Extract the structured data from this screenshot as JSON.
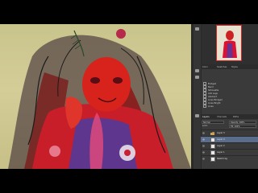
{
  "window": {
    "title": ""
  },
  "panels": {
    "mini_tabs": [
      "Navigator",
      "Histogram",
      "Info"
    ],
    "history_tabs": [
      "Color",
      "Swatches",
      "Styles"
    ],
    "history_items": [
      "Bridged",
      "Bend",
      "Silhouette",
      "Add Legs",
      "Abstract",
      "Lines Bridged",
      "Lines Bright",
      "Lines"
    ],
    "layer_tabs": [
      "Layers",
      "Channels",
      "Paths"
    ],
    "blend_mode": "Normal",
    "opacity_label": "Opacity: 100%",
    "lock_label": "Lock:",
    "fill_label": "Fill: 100%",
    "group_name": "Layer 3",
    "layers": [
      {
        "name": "Layer 4",
        "selected": true
      },
      {
        "name": "Layer 2",
        "selected": false
      },
      {
        "name": "Layer 1",
        "selected": false
      },
      {
        "name": "Sketch bg",
        "selected": false
      }
    ]
  },
  "icons": {
    "eye": "eye-icon",
    "folder": "folder-icon",
    "brush": "brush-icon"
  },
  "colors": {
    "panel_bg": "#3a3a3a",
    "selected_layer": "#5b6d8c",
    "canvas_bg": "#cdc692",
    "art_red": "#d61f1f"
  }
}
